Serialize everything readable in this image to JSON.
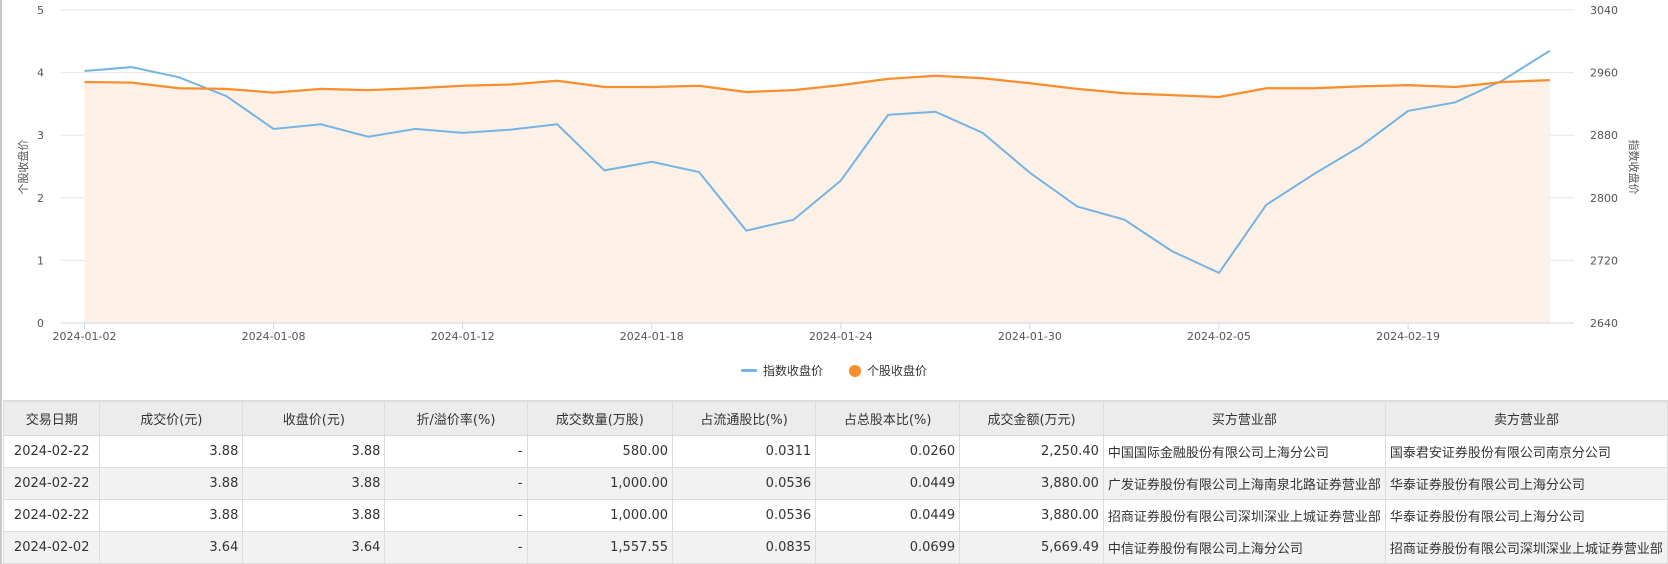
{
  "chart_data": {
    "type": "line",
    "title": "",
    "x": [
      "2024-01-02",
      "2024-01-03",
      "2024-01-04",
      "2024-01-05",
      "2024-01-08",
      "2024-01-09",
      "2024-01-10",
      "2024-01-11",
      "2024-01-12",
      "2024-01-15",
      "2024-01-16",
      "2024-01-17",
      "2024-01-18",
      "2024-01-19",
      "2024-01-22",
      "2024-01-23",
      "2024-01-24",
      "2024-01-25",
      "2024-01-26",
      "2024-01-29",
      "2024-01-30",
      "2024-01-31",
      "2024-02-01",
      "2024-02-02",
      "2024-02-05",
      "2024-02-06",
      "2024-02-07",
      "2024-02-08",
      "2024-02-19",
      "2024-02-20",
      "2024-02-21",
      "2024-02-22"
    ],
    "x_tick_labels": [
      "2024-01-02",
      "2024-01-08",
      "2024-01-12",
      "2024-01-18",
      "2024-01-24",
      "2024-01-30",
      "2024-02-05",
      "2024-02-19"
    ],
    "ylabel": "个股收盘价",
    "ylabel_right": "指数收盘价",
    "ylim": [
      0,
      5
    ],
    "ylim_right": [
      2640,
      3040
    ],
    "yticks": [
      "0",
      "1",
      "2",
      "3",
      "4",
      "5"
    ],
    "yticks_right": [
      "2640",
      "2720",
      "2800",
      "2880",
      "2960",
      "3040"
    ],
    "grid": true,
    "legend_position": "bottom",
    "series": [
      {
        "name": "指数收盘价",
        "axis": "right",
        "style": "line",
        "color": "#73b4e3",
        "values": [
          2962,
          2967,
          2954,
          2930,
          2888,
          2894,
          2878,
          2888,
          2883,
          2887,
          2894,
          2835,
          2846,
          2833,
          2758,
          2772,
          2822,
          2906,
          2910,
          2883,
          2832,
          2789,
          2772,
          2732,
          2704,
          2791,
          2830,
          2866,
          2911,
          2922,
          2950,
          2988
        ]
      },
      {
        "name": "个股收盘价",
        "axis": "left",
        "style": "area",
        "color": "#f98e2c",
        "fill": "#fdf0e6",
        "values": [
          3.85,
          3.84,
          3.75,
          3.74,
          3.68,
          3.74,
          3.72,
          3.75,
          3.79,
          3.81,
          3.87,
          3.77,
          3.77,
          3.79,
          3.69,
          3.72,
          3.8,
          3.9,
          3.95,
          3.91,
          3.83,
          3.74,
          3.67,
          3.64,
          3.61,
          3.75,
          3.75,
          3.78,
          3.8,
          3.77,
          3.85,
          3.88
        ]
      }
    ]
  },
  "table": {
    "headers": [
      "交易日期",
      "成交价(元)",
      "收盘价(元)",
      "折/溢价率(%)",
      "成交数量(万股)",
      "占流通股比(%)",
      "占总股本比(%)",
      "成交金额(万元)",
      "买方营业部",
      "卖方营业部"
    ],
    "rows": [
      [
        "2024-02-22",
        "3.88",
        "3.88",
        "-",
        "580.00",
        "0.0311",
        "0.0260",
        "2,250.40",
        "中国国际金融股份有限公司上海分公司",
        "国泰君安证券股份有限公司南京分公司"
      ],
      [
        "2024-02-22",
        "3.88",
        "3.88",
        "-",
        "1,000.00",
        "0.0536",
        "0.0449",
        "3,880.00",
        "广发证券股份有限公司上海南泉北路证券营业部",
        "华泰证券股份有限公司上海分公司"
      ],
      [
        "2024-02-22",
        "3.88",
        "3.88",
        "-",
        "1,000.00",
        "0.0536",
        "0.0449",
        "3,880.00",
        "招商证券股份有限公司深圳深业上城证券营业部",
        "华泰证券股份有限公司上海分公司"
      ],
      [
        "2024-02-02",
        "3.64",
        "3.64",
        "-",
        "1,557.55",
        "0.0835",
        "0.0699",
        "5,669.49",
        "中信证券股份有限公司上海分公司",
        "招商证券股份有限公司深圳深业上城证券营业部"
      ]
    ]
  }
}
